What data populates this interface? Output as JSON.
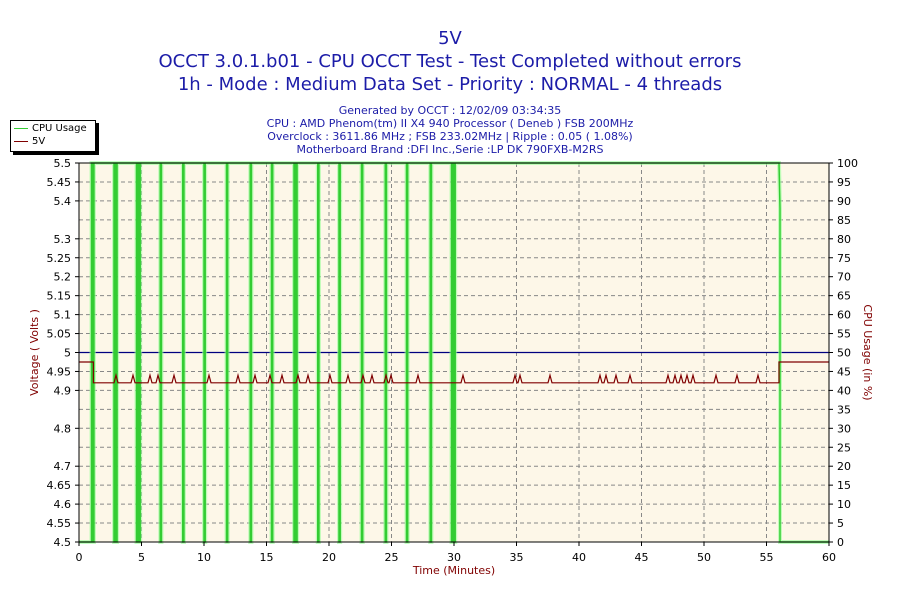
{
  "chart_data": {
    "type": "line",
    "title": "5V",
    "subtitle": [
      "OCCT 3.0.1.b01 - CPU OCCT Test - Test Completed without errors",
      "1h - Mode : Medium Data Set - Priority : NORMAL - 4 threads"
    ],
    "info": [
      "Generated by OCCT : 12/02/09 03:34:35",
      "CPU : AMD Phenom(tm) II X4 940 Processor ( Deneb ) FSB 200MHz",
      "Overclock : 3611.86 MHz ; FSB 233.02MHz | Ripple : 0.05 ( 1.08%)",
      "Motherboard Brand :DFI Inc.,Serie :LP DK 790FXB-M2RS"
    ],
    "xlabel": "Time (Minutes)",
    "ylabel": "Voltage ( Volts )",
    "y2label": "CPU Usage (in %)",
    "xlim": [
      0,
      60
    ],
    "ylim": [
      4.5,
      5.5
    ],
    "y2lim": [
      0,
      100
    ],
    "xticks": [
      "0",
      "5",
      "10",
      "15",
      "20",
      "25",
      "30",
      "35",
      "40",
      "45",
      "50",
      "55",
      "60"
    ],
    "yticks": [
      "5.5",
      "5.45",
      "5.4",
      "5.3",
      "5.25",
      "5.2",
      "5.15",
      "5.1",
      "5.05",
      "5",
      "4.95",
      "4.9",
      "4.8",
      "4.7",
      "4.65",
      "4.6",
      "4.55",
      "4.5"
    ],
    "ytick_values": [
      5.5,
      5.45,
      5.4,
      5.3,
      5.25,
      5.2,
      5.15,
      5.1,
      5.05,
      5,
      4.95,
      4.9,
      4.8,
      4.7,
      4.65,
      4.6,
      4.55,
      4.5
    ],
    "y2ticks": [
      "100",
      "95",
      "90",
      "85",
      "80",
      "75",
      "70",
      "65",
      "60",
      "55",
      "50",
      "45",
      "40",
      "35",
      "30",
      "25",
      "20",
      "15",
      "10",
      "5",
      "0"
    ],
    "grid": true,
    "legend_position": "top-left",
    "reference_line": 5.0,
    "series": [
      {
        "name": "CPU Usage",
        "color": "#33cc33",
        "axis": "right",
        "start": 1.0,
        "end": 56.0,
        "level": 100,
        "dips_to_zero_at": [
          1.1,
          2.8,
          2.95,
          4.6,
          4.8,
          6.5,
          8.3,
          10.0,
          11.8,
          13.7,
          15.4,
          17.2,
          17.35,
          19.1,
          20.8,
          22.6,
          24.5,
          26.2,
          28.1,
          29.8,
          30.0
        ]
      },
      {
        "name": "5V",
        "color": "#800000",
        "axis": "left",
        "baseline_idle": 4.975,
        "baseline_load": 4.92,
        "load_start": 1.15,
        "load_end": 56.0,
        "spike_value": 4.94,
        "spike_times": [
          2.96,
          4.32,
          5.68,
          6.32,
          7.6,
          10.4,
          12.72,
          14.08,
          15.28,
          16.24,
          17.52,
          18.32,
          20.08,
          21.52,
          22.72,
          23.44,
          24.56,
          24.96,
          27.12,
          30.72,
          34.88,
          35.28,
          37.68,
          41.68,
          42.16,
          42.96,
          44.08,
          47.12,
          47.68,
          48.16,
          48.64,
          49.12,
          50.96,
          52.64,
          54.32
        ]
      }
    ]
  }
}
